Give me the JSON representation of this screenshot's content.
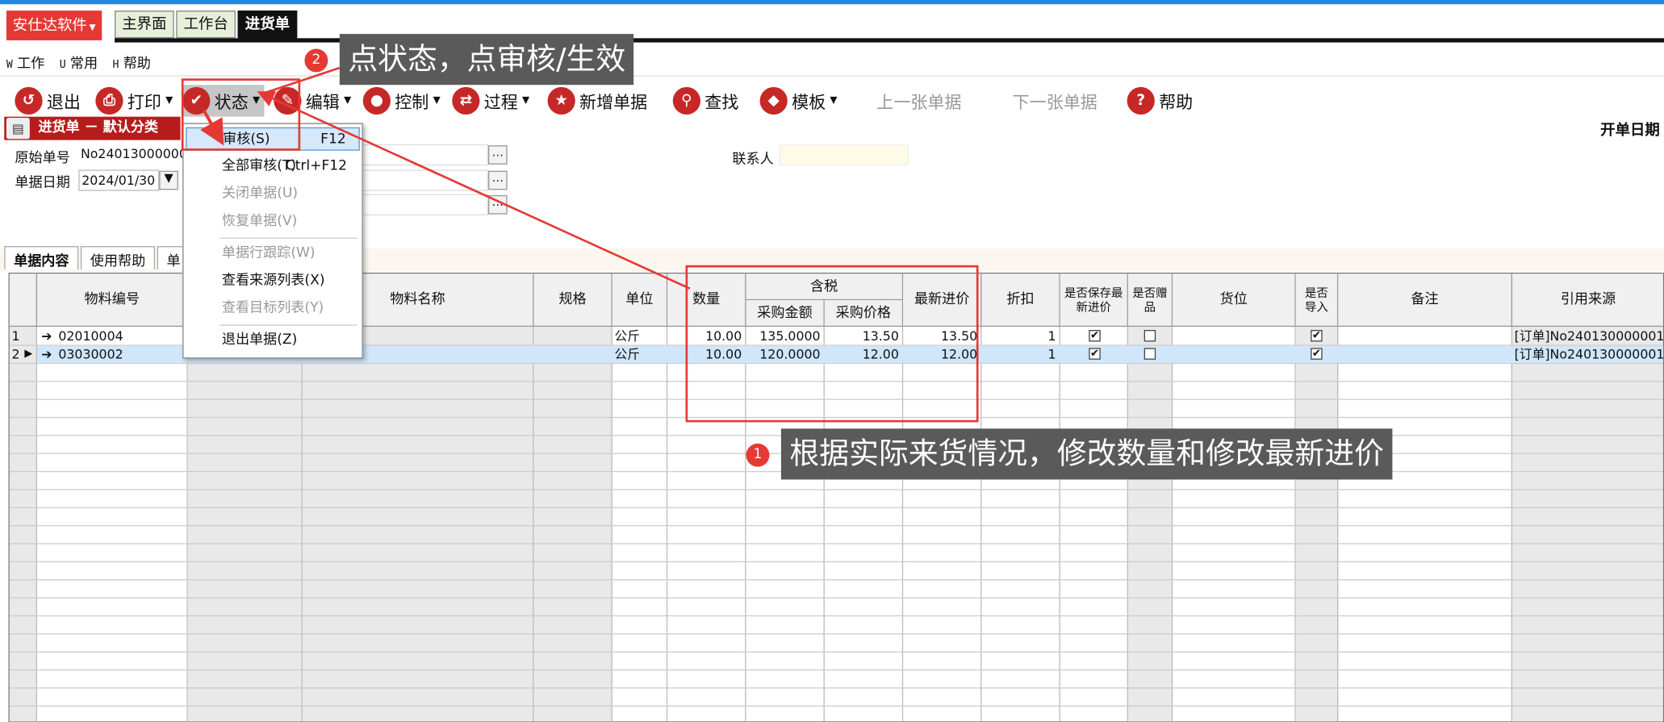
{
  "app": {
    "brand": "安仕达软件",
    "tabs": [
      "主界面",
      "工作台",
      "进货单"
    ]
  },
  "menu": [
    {
      "key": "W",
      "label": "工作"
    },
    {
      "key": "U",
      "label": "常用"
    },
    {
      "key": "H",
      "label": "帮助"
    }
  ],
  "toolbar": {
    "exit": "退出",
    "print": "打印",
    "status": "状态",
    "edit": "编辑",
    "control": "控制",
    "process": "过程",
    "new_doc": "新增单据",
    "find": "查找",
    "template": "模板",
    "prev_doc": "上一张单据",
    "next_doc": "下一张单据",
    "help": "帮助"
  },
  "doc": {
    "title": "进货单 － 默认分类",
    "open_date_label": "开单日期",
    "source_no_label": "原始单号",
    "source_no": "No24013000000",
    "date_label": "单据日期",
    "date": "2024/01/30",
    "contact_label": "联系人",
    "contact": ""
  },
  "subtabs": [
    "单据内容",
    "使用帮助",
    "单"
  ],
  "grid": {
    "headers": {
      "code": "物料编号",
      "name": "物料名称",
      "spec": "规格",
      "unit": "单位",
      "qty": "数量",
      "tax_group": "含税",
      "amount": "采购金额",
      "price": "采购价格",
      "latest": "最新进价",
      "discount": "折扣",
      "save_latest": "是否保存最新进价",
      "gift": "是否赠品",
      "location": "货位",
      "imported": "是否导入",
      "remark": "备注",
      "source": "引用来源"
    },
    "rows": [
      {
        "no": "1",
        "code": "02010004",
        "unit": "公斤",
        "qty": "10.00",
        "amount": "135.0000",
        "price": "13.50",
        "latest": "13.50",
        "discount": "1",
        "save_latest": true,
        "gift": false,
        "imported": true,
        "source": "[订单]No240130000001"
      },
      {
        "no": "2",
        "code": "03030002",
        "unit": "公斤",
        "qty": "10.00",
        "amount": "120.0000",
        "price": "12.00",
        "latest": "12.00",
        "discount": "1",
        "save_latest": true,
        "gift": false,
        "imported": true,
        "source": "[订单]No240130000001"
      }
    ]
  },
  "status_menu": {
    "items": [
      {
        "label": "审核(S)",
        "shortcut": "F12",
        "enabled": true,
        "highlighted": true
      },
      {
        "label": "全部审核(T)",
        "shortcut": "Ctrl+F12",
        "enabled": true
      },
      {
        "label": "关闭单据(U)",
        "shortcut": "",
        "enabled": false
      },
      {
        "label": "恢复单据(V)",
        "shortcut": "",
        "enabled": false
      },
      {
        "label": "单据行跟踪(W)",
        "shortcut": "",
        "enabled": false
      },
      {
        "label": "查看来源列表(X)",
        "shortcut": "",
        "enabled": true
      },
      {
        "label": "查看目标列表(Y)",
        "shortcut": "",
        "enabled": false
      },
      {
        "label": "退出单据(Z)",
        "shortcut": "",
        "enabled": true
      }
    ]
  },
  "annotations": {
    "step1_num": "1",
    "step1": "根据实际来货情况，修改数量和修改最新进价",
    "step2_num": "2",
    "step2": "点状态，点审核/生效"
  },
  "colors": {
    "accent_red": "#e53935",
    "brand_red": "#e53935",
    "callout_bg": "#5a5a5a",
    "selected_row": "#cfe6fb"
  }
}
